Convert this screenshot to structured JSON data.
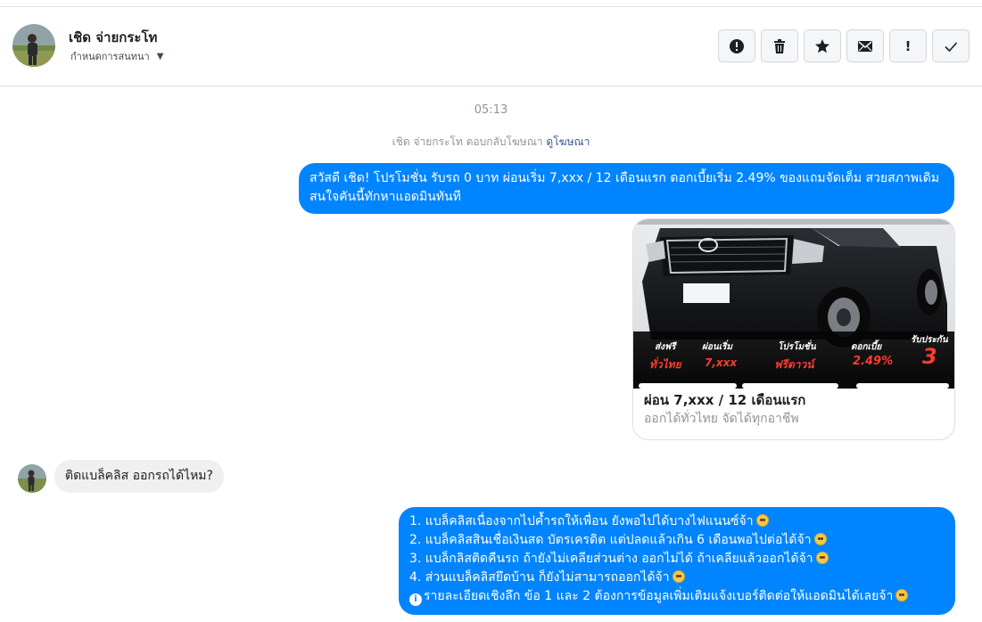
{
  "header": {
    "contact_name": "เชิด จ่ายกระโท",
    "subtitle": "กำหนดการสนทนา",
    "actions": [
      {
        "name": "spam",
        "icon": "exclamation-circle-icon"
      },
      {
        "name": "delete",
        "icon": "trash-icon"
      },
      {
        "name": "star",
        "icon": "star-icon"
      },
      {
        "name": "mark-unread",
        "icon": "envelope-icon"
      },
      {
        "name": "follow-up",
        "label": "!"
      },
      {
        "name": "done",
        "icon": "checkmark-icon"
      }
    ]
  },
  "conversation": {
    "timestamp": "05:13",
    "reply_note": "เชิด จ่ายกระโท ตอบกลับโฆษณา",
    "reply_link": "ดูโฆษณา",
    "messages": [
      {
        "type": "outgoing",
        "text": "สวัสดี เชิด! โปรโมชั่น รับรถ 0 บาท ผ่อนเริ่ม 7,xxx / 12 เดือนแรก ดอกเบี้ยเริ่ม 2.49% ของแถมจัดเต็ม สวยสภาพเดิม สนใจคันนี้ทักหาแอดมินทันที"
      },
      {
        "type": "ad-card",
        "title": "ผ่อน 7,xxx / 12 เดือนแรก",
        "subtitle": "ออกได้ทั่วไทย จัดได้ทุกอาชีพ",
        "promo": [
          {
            "label": "ส่งฟรี",
            "value": "ทั่วไทย"
          },
          {
            "label": "ผ่อนเริ่ม",
            "value": "7,xxx"
          },
          {
            "label": "โปรโมชั่น",
            "value": "ฟรีดาวน์"
          },
          {
            "label": "ดอกเบี้ย",
            "value": "2.49%"
          },
          {
            "label": "รับประกัน",
            "value": "3"
          }
        ],
        "brand_color": "#ff3b30"
      },
      {
        "type": "incoming",
        "text": "ติดแบล็คลิส ออกรถได้ไหม?"
      },
      {
        "type": "outgoing",
        "lines": [
          "1. แบล็คลิสเนื่องจากไปค้ำรถให้เพื่อน ยังพอไปได้บางไฟแนนซ์จ้า",
          "2. แบล็คลิสสินเชื่อเงินสด บัตรเครดิต แต่ปลดแล้วเกิน 6 เดือนพอไปต่อได้จ้า",
          "3. แบล็กลิสติดคืนรถ ถ้ายังไม่เคลียส่วนต่าง ออกไม่ได้ ถ้าเคลียแล้วออกได้จ้า",
          "4. ส่วนแบล็คลิสยึดบ้าน ก็ยังไม่สามารถออกได้จ้า",
          "รายละเอียดเชิงลึก ข้อ 1 และ 2 ต้องการข้อมูลเพิ่มเติมแจ้งเบอร์ติดต่อให้แอดมินได้เลยจ้า"
        ]
      }
    ]
  },
  "colors": {
    "outgoing_bubble": "#0084ff",
    "incoming_bubble": "#f1f0f0",
    "link": "#385898"
  }
}
